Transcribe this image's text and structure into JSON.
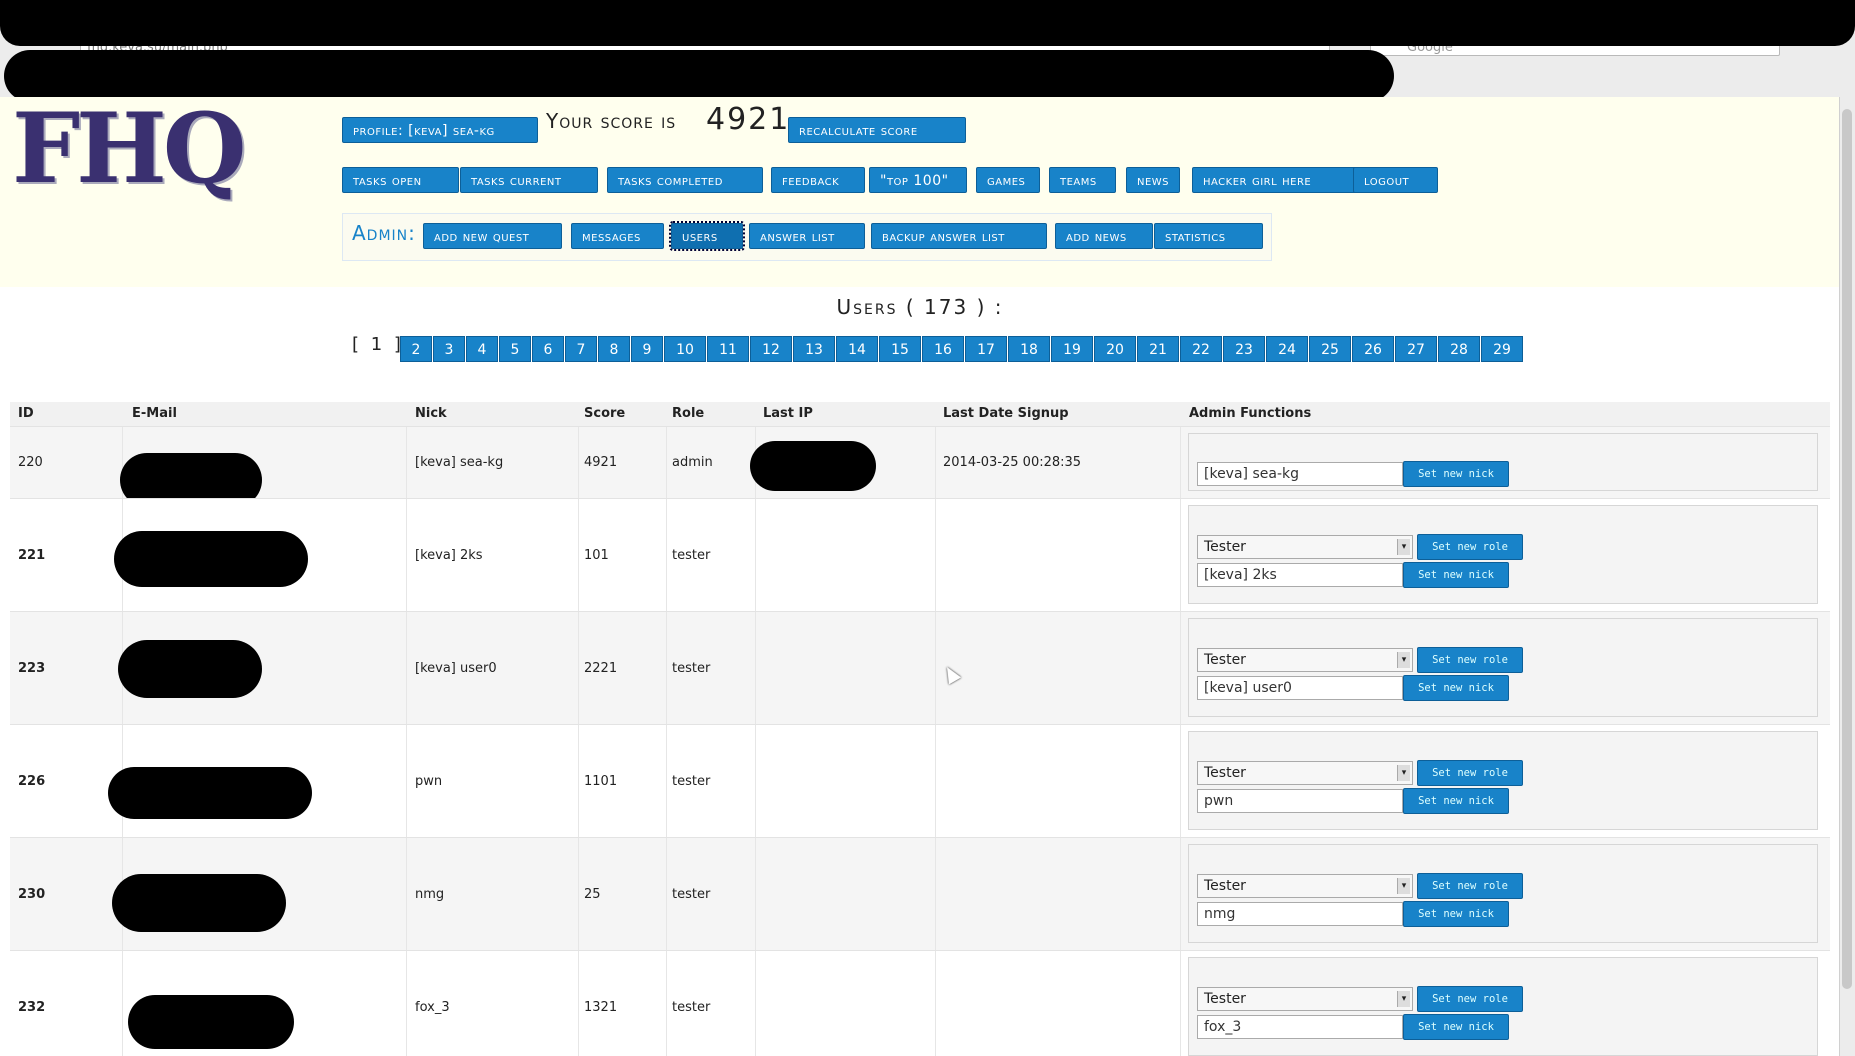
{
  "browser": {
    "url": "fhq.keva.su/main.php",
    "search_placeholder": "Google"
  },
  "logo": "FHQ",
  "header": {
    "profile": "Profile: [keva] sea-kg",
    "score_label": "Your score is",
    "score_value": "4921",
    "recalculate": "Recalculate score"
  },
  "nav": [
    "Tasks open",
    "Tasks current",
    "Tasks completed",
    "Feedback",
    "\"Top 100\"",
    "Games",
    "Teams",
    "News",
    "Hacker girl here",
    "Logout"
  ],
  "admin": {
    "label": "Admin:",
    "items": [
      "Add new quest",
      "Messages",
      "Users",
      "Answer list",
      "Backup answer list",
      "Add news",
      "Statistics"
    ]
  },
  "users_title": "Users ( 173 ) :",
  "pagination": {
    "current": "[ 1 ]",
    "pages": [
      "2",
      "3",
      "4",
      "5",
      "6",
      "7",
      "8",
      "9",
      "10",
      "11",
      "12",
      "13",
      "14",
      "15",
      "16",
      "17",
      "18",
      "19",
      "20",
      "21",
      "22",
      "23",
      "24",
      "25",
      "26",
      "27",
      "28",
      "29"
    ]
  },
  "table": {
    "headers": [
      "ID",
      "E-Mail",
      "Nick",
      "Score",
      "Role",
      "Last IP",
      "Last Date Signup",
      "Admin Functions"
    ],
    "rows": [
      {
        "id": "220",
        "nick": "[keva] sea-kg",
        "score": "4921",
        "role": "admin",
        "date": "2014-03-25 00:28:35",
        "role_select": "",
        "nick_input": "[keva] sea-kg"
      },
      {
        "id": "221",
        "nick": "[keva] 2ks",
        "score": "101",
        "role": "tester",
        "date": "",
        "role_select": "Tester",
        "nick_input": "[keva] 2ks"
      },
      {
        "id": "223",
        "nick": "[keva] user0",
        "score": "2221",
        "role": "tester",
        "date": "",
        "role_select": "Tester",
        "nick_input": "[keva] user0"
      },
      {
        "id": "226",
        "nick": "pwn",
        "score": "1101",
        "role": "tester",
        "date": "",
        "role_select": "Tester",
        "nick_input": "pwn"
      },
      {
        "id": "230",
        "nick": "nmg",
        "score": "25",
        "role": "tester",
        "date": "",
        "role_select": "Tester",
        "nick_input": "nmg"
      },
      {
        "id": "232",
        "nick": "fox_3",
        "score": "1321",
        "role": "tester",
        "date": "",
        "role_select": "Tester",
        "nick_input": "fox_3"
      }
    ],
    "set_role_label": "Set new role",
    "set_nick_label": "Set new nick"
  }
}
